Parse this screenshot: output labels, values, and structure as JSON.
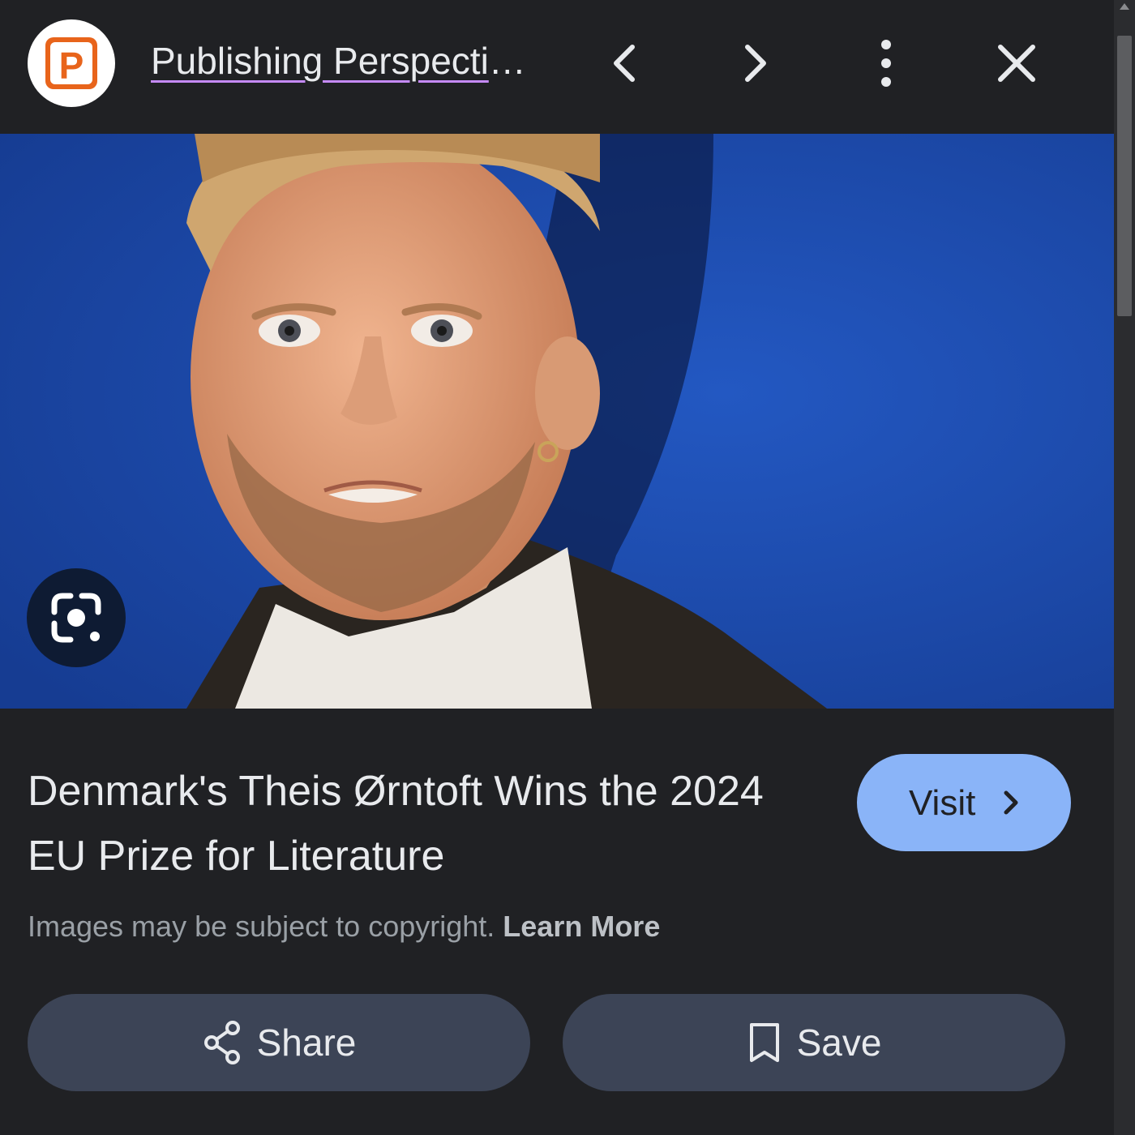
{
  "header": {
    "source_title": "Publishing Perspectives",
    "logo_letter": "P",
    "prev_icon": "chevron-left-icon",
    "next_icon": "chevron-right-icon",
    "more_icon": "more-vert-icon",
    "close_icon": "close-icon"
  },
  "image": {
    "lens_icon": "google-lens-icon"
  },
  "article": {
    "title": "Denmark's Theis Ørntoft Wins the 2024 EU Prize for Literature",
    "visit_label": "Visit"
  },
  "copyright": {
    "notice": "Images may be subject to copyright.",
    "learn_more": "Learn More"
  },
  "actions": {
    "share_label": "Share",
    "save_label": "Save"
  },
  "colors": {
    "panel_bg": "#202124",
    "visit_bg": "#8ab4f8",
    "action_bg": "#3c4456",
    "link_underline": "#c58af9",
    "logo_accent": "#e8641b"
  }
}
